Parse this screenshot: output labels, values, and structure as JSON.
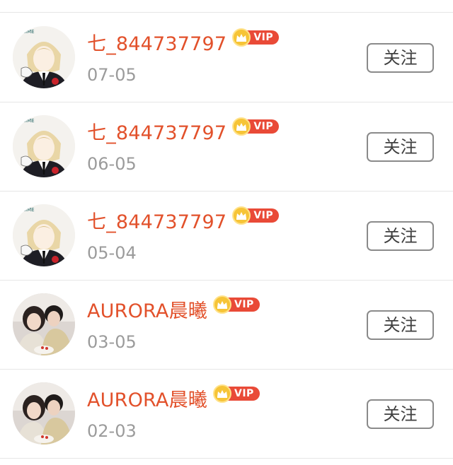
{
  "rows": [
    {
      "name": "七_844737797",
      "vip": "VIP",
      "date": "07-05",
      "button": "关注",
      "avatar": "anime-boy-avatar"
    },
    {
      "name": "七_844737797",
      "vip": "VIP",
      "date": "06-05",
      "button": "关注",
      "avatar": "anime-boy-avatar"
    },
    {
      "name": "七_844737797",
      "vip": "VIP",
      "date": "05-04",
      "button": "关注",
      "avatar": "anime-boy-avatar"
    },
    {
      "name": "AURORA晨曦",
      "vip": "VIP",
      "date": "03-05",
      "button": "关注",
      "avatar": "couple-photo-avatar"
    },
    {
      "name": "AURORA晨曦",
      "vip": "VIP",
      "date": "02-03",
      "button": "关注",
      "avatar": "couple-photo-avatar"
    }
  ],
  "colors": {
    "username": "#e2512b",
    "vip_tag": "#e94a37",
    "crown": "#f6c437",
    "date": "#9b9b9b",
    "button_border": "#8a8a8a",
    "divider": "#e6e6e6"
  },
  "icons": {
    "crown": "crown-icon"
  }
}
